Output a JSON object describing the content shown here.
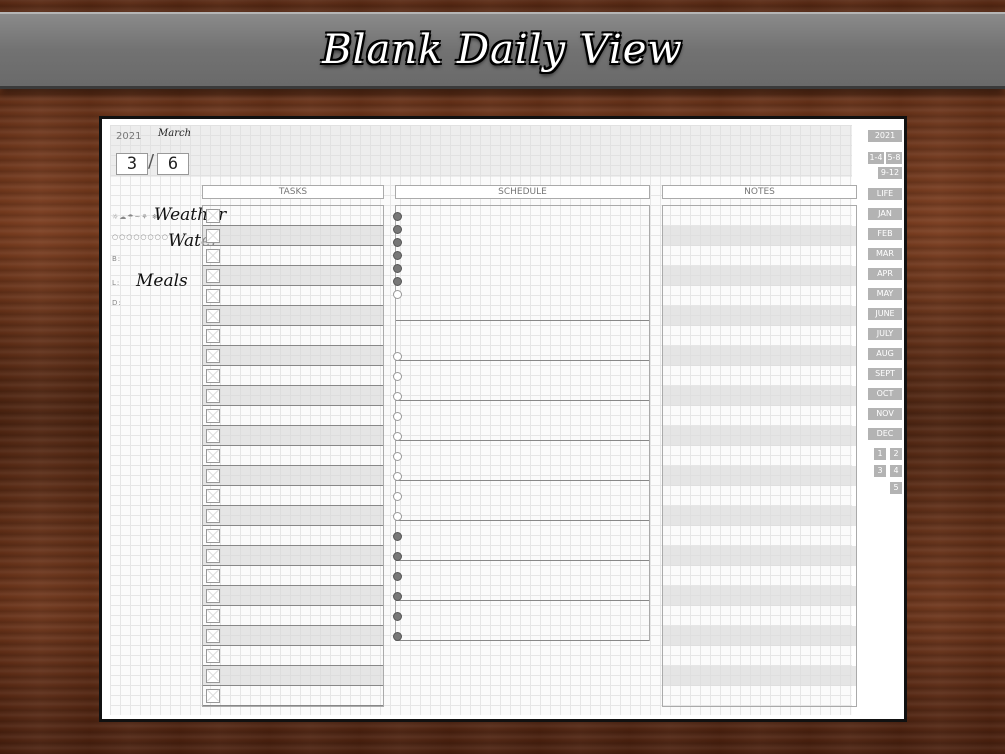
{
  "banner": {
    "title": "Blank Daily View"
  },
  "planner": {
    "year": "2021",
    "month": "March",
    "month_num": "3",
    "day_num": "6",
    "slash": "/",
    "trackers": {
      "weather_icons": "☼☁☂~⚘ ❄",
      "weather_label": "Weather",
      "water_icons": "○○○○○○○○",
      "water_label": "Water",
      "meal_marks": [
        "B:",
        "L:",
        "D:",
        "S:"
      ],
      "meals_label": "Meals"
    },
    "columns": {
      "tasks": "TASKS",
      "schedule": "SCHEDULE",
      "notes": "NOTES"
    },
    "task_rows": 25,
    "schedule_hours": 22
  },
  "sidebar": {
    "year": "2021",
    "weeks": [
      "1-4",
      "5-8",
      "9-12"
    ],
    "life": "LIFE",
    "months": [
      "JAN",
      "FEB",
      "MAR",
      "APR",
      "MAY",
      "JUNE",
      "JULY",
      "AUG",
      "SEPT",
      "OCT",
      "NOV",
      "DEC"
    ],
    "pages": [
      "1",
      "2",
      "3",
      "4",
      "5"
    ]
  }
}
